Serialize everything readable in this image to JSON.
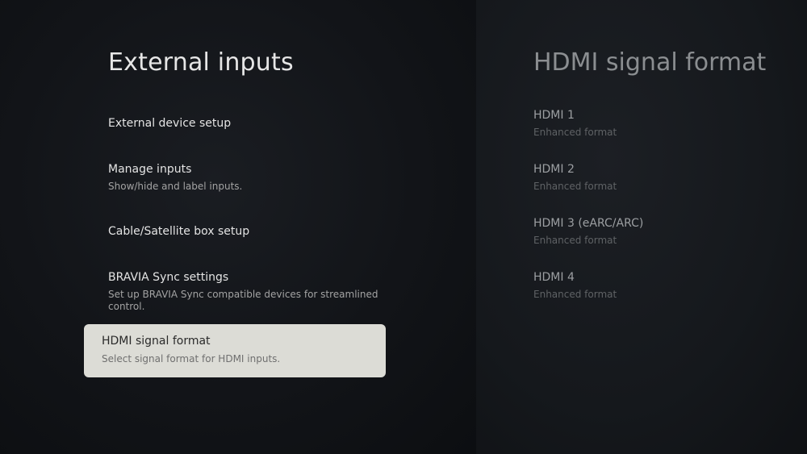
{
  "left_panel": {
    "title": "External inputs",
    "items": [
      {
        "label": "External device setup",
        "description": ""
      },
      {
        "label": "Manage inputs",
        "description": "Show/hide and label inputs."
      },
      {
        "label": "Cable/Satellite box setup",
        "description": ""
      },
      {
        "label": "BRAVIA Sync settings",
        "description": "Set up BRAVIA Sync compatible devices for streamlined control."
      },
      {
        "label": "HDMI signal format",
        "description": "Select signal format for HDMI inputs."
      }
    ]
  },
  "right_panel": {
    "title": "HDMI signal format",
    "items": [
      {
        "label": "HDMI 1",
        "value": "Enhanced format"
      },
      {
        "label": "HDMI 2",
        "value": "Enhanced format"
      },
      {
        "label": "HDMI 3 (eARC/ARC)",
        "value": "Enhanced format"
      },
      {
        "label": "HDMI 4",
        "value": "Enhanced format"
      }
    ]
  }
}
